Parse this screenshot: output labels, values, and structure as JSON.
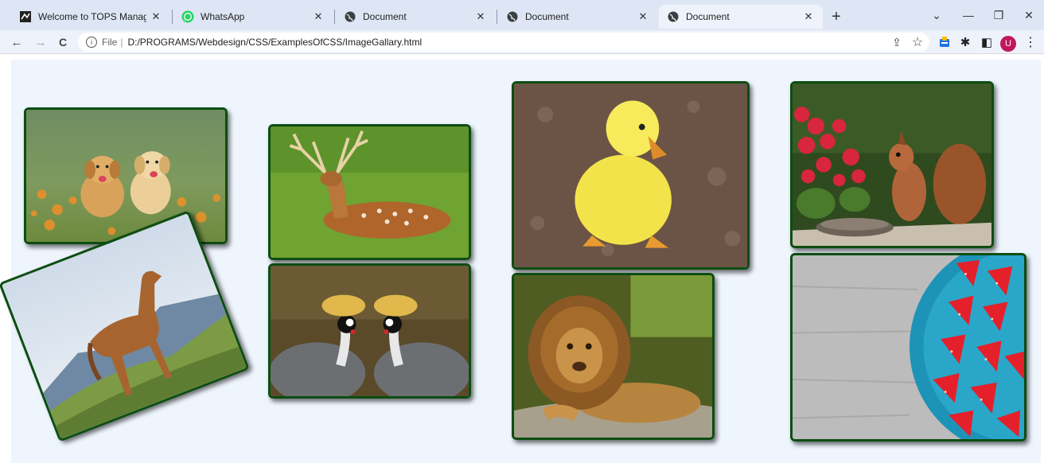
{
  "browser": {
    "tabs": [
      {
        "title": "Welcome to TOPS Management",
        "favicon": "tops-favicon-icon",
        "active": false
      },
      {
        "title": "WhatsApp",
        "favicon": "whatsapp-icon",
        "active": false
      },
      {
        "title": "Document",
        "favicon": "globe-icon",
        "active": false
      },
      {
        "title": "Document",
        "favicon": "globe-icon",
        "active": false
      },
      {
        "title": "Document",
        "favicon": "globe-icon",
        "active": true
      }
    ],
    "close_glyph": "✕",
    "new_tab_glyph": "+",
    "window_controls": {
      "dropdown": "⌄",
      "minimize": "—",
      "restore": "❐",
      "close": "✕"
    },
    "address": {
      "info_glyph": "i",
      "scheme_label": "File",
      "divider": "|",
      "url": "D:/PROGRAMS/Webdesign/CSS/ExamplesOfCSS/ImageGallary.html"
    },
    "nav_glyphs": {
      "back": "←",
      "forward": "→",
      "reload": "C"
    },
    "toolbar_glyphs": {
      "share": "⇪",
      "bookmark": "☆",
      "extension": "✱",
      "sidepanel": "◧",
      "menu": "⋮"
    },
    "profile_initial": "U"
  },
  "gallery": {
    "images": [
      {
        "subject": "two golden retriever puppies in a flower field"
      },
      {
        "subject": "chestnut horse on a grassy hillside"
      },
      {
        "subject": "fallow deer lying in grass"
      },
      {
        "subject": "two grey crowned cranes"
      },
      {
        "subject": "yellow duckling on soil"
      },
      {
        "subject": "lion resting on a rock"
      },
      {
        "subject": "red squirrel beside red flowers and a bowl"
      },
      {
        "subject": "strawberries in a blue bowl on grey wood"
      }
    ],
    "frame_color": "#0d4d12",
    "background_color": "#eef5fd"
  }
}
